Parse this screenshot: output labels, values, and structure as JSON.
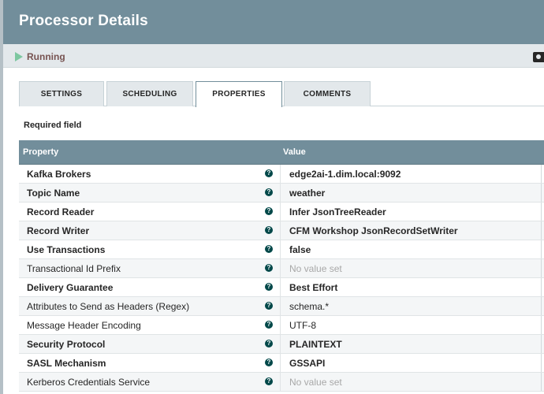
{
  "header": {
    "title": "Processor Details"
  },
  "status": {
    "label": "Running",
    "icon": "play-icon",
    "color": "#7dc7a0"
  },
  "tabs": [
    {
      "label": "SETTINGS",
      "active": false
    },
    {
      "label": "SCHEDULING",
      "active": false
    },
    {
      "label": "PROPERTIES",
      "active": true
    },
    {
      "label": "COMMENTS",
      "active": false
    }
  ],
  "required_label": "Required field",
  "table": {
    "columns": [
      "Property",
      "Value"
    ],
    "rows": [
      {
        "name": "Kafka Brokers",
        "value": "edge2ai-1.dim.local:9092",
        "required": true,
        "empty": false
      },
      {
        "name": "Topic Name",
        "value": "weather",
        "required": true,
        "empty": false
      },
      {
        "name": "Record Reader",
        "value": "Infer JsonTreeReader",
        "required": true,
        "empty": false
      },
      {
        "name": "Record Writer",
        "value": "CFM Workshop JsonRecordSetWriter",
        "required": true,
        "empty": false
      },
      {
        "name": "Use Transactions",
        "value": "false",
        "required": true,
        "empty": false
      },
      {
        "name": "Transactional Id Prefix",
        "value": "No value set",
        "required": false,
        "empty": true
      },
      {
        "name": "Delivery Guarantee",
        "value": "Best Effort",
        "required": true,
        "empty": false
      },
      {
        "name": "Attributes to Send as Headers (Regex)",
        "value": "schema.*",
        "required": false,
        "empty": false
      },
      {
        "name": "Message Header Encoding",
        "value": "UTF-8",
        "required": false,
        "empty": false
      },
      {
        "name": "Security Protocol",
        "value": "PLAINTEXT",
        "required": true,
        "empty": false
      },
      {
        "name": "SASL Mechanism",
        "value": "GSSAPI",
        "required": true,
        "empty": false
      },
      {
        "name": "Kerberos Credentials Service",
        "value": "No value set",
        "required": false,
        "empty": true
      }
    ],
    "help_icon": "question-circle-icon"
  },
  "colors": {
    "header": "#728e9b",
    "accent": "#004849",
    "running": "#7dc7a0"
  }
}
